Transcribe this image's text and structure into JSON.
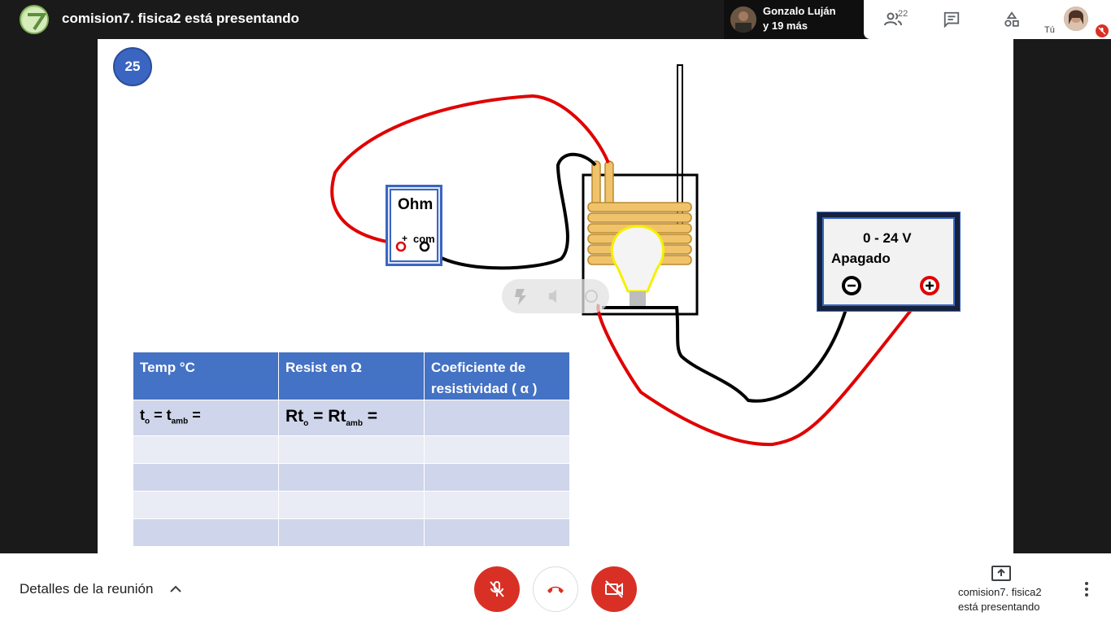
{
  "header": {
    "presenter_title": "comision7. fisica2 está presentando",
    "participant_name": "Gonzalo Luján",
    "participant_more": "y 19 más",
    "participants_count": "22",
    "self_label": "Tú"
  },
  "slide": {
    "number": "25",
    "ohmmeter": {
      "title": "Ohm",
      "plus_label": "+",
      "com_label": "com"
    },
    "power_supply": {
      "range": "0 - 24 V",
      "state": "Apagado"
    },
    "table": {
      "headers": [
        "Temp  °C",
        "Resist  en  Ω",
        "Coeficiente de resistividad  ( α )"
      ],
      "row1": {
        "temp": {
          "t": "t",
          "sub_o": "o",
          "eq": " = t",
          "sub_amb": "amb",
          "tail": " ="
        },
        "resist": {
          "rt": "Rt",
          "sub_o": "o",
          "eq": " = Rt",
          "sub_amb": "amb",
          "tail": " ="
        }
      }
    }
  },
  "footer": {
    "meeting_details": "Detalles de la reunión",
    "presenter_name": "comision7. fisica2",
    "presenter_status": "está presentando"
  },
  "colors": {
    "accent_red": "#d93025",
    "slide_blue": "#4472c4",
    "wire_red": "#e00000"
  },
  "icons": [
    "chevron-up-icon",
    "mic-off-icon",
    "hang-up-icon",
    "camera-off-icon",
    "present-icon",
    "more-vert-icon",
    "people-icon",
    "chat-icon",
    "activities-icon"
  ]
}
